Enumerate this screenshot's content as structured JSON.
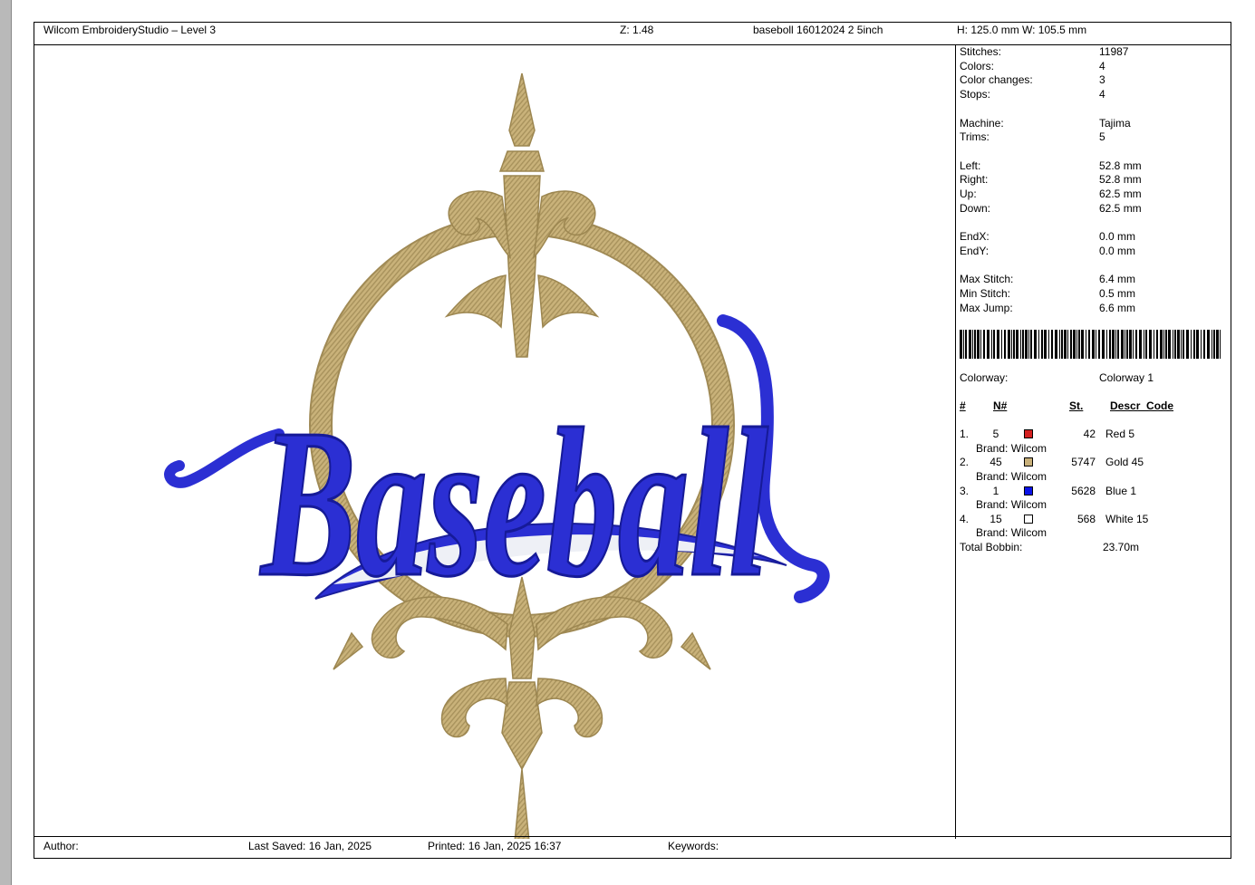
{
  "header": {
    "app_title": "Wilcom EmbroideryStudio – Level 3",
    "zoom": "Z: 1.48",
    "design_name": "baseboll 16012024 2 5inch",
    "dimensions": "H: 125.0 mm   W: 105.5 mm"
  },
  "design": {
    "text": "Baseball",
    "colors": {
      "gold": "#c9b27a",
      "blue": "#2b2fd3",
      "white": "#eef0f6"
    }
  },
  "stats": [
    {
      "label": "Stitches:",
      "value": "11987"
    },
    {
      "label": "Colors:",
      "value": "4"
    },
    {
      "label": "Color changes:",
      "value": "3"
    },
    {
      "label": "Stops:",
      "value": "4"
    },
    {
      "label": "Machine:",
      "value": "Tajima"
    },
    {
      "label": "Trims:",
      "value": "5"
    },
    {
      "label": "Left:",
      "value": "52.8 mm"
    },
    {
      "label": "Right:",
      "value": "52.8 mm"
    },
    {
      "label": "Up:",
      "value": "62.5 mm"
    },
    {
      "label": "Down:",
      "value": "62.5 mm"
    },
    {
      "label": "EndX:",
      "value": "0.0 mm"
    },
    {
      "label": "EndY:",
      "value": "0.0 mm"
    },
    {
      "label": "Max Stitch:",
      "value": "6.4 mm"
    },
    {
      "label": "Min Stitch:",
      "value": "0.5 mm"
    },
    {
      "label": "Max Jump:",
      "value": "6.6 mm"
    }
  ],
  "colorway": {
    "label": "Colorway:",
    "value": "Colorway 1"
  },
  "table_headers": {
    "index": "#",
    "needle": "N#",
    "stitches": "St.",
    "descr": "Descr_Code"
  },
  "threads": [
    {
      "index": "1.",
      "needle": "5",
      "color": "#d42020",
      "stitches": "42",
      "descr": "Red 5",
      "brand": "Brand: Wilcom"
    },
    {
      "index": "2.",
      "needle": "45",
      "color": "#c8b07a",
      "stitches": "5747",
      "descr": "Gold 45",
      "brand": "Brand: Wilcom"
    },
    {
      "index": "3.",
      "needle": "1",
      "color": "#0a12e8",
      "stitches": "5628",
      "descr": "Blue 1",
      "brand": "Brand: Wilcom"
    },
    {
      "index": "4.",
      "needle": "15",
      "color": "#ffffff",
      "stitches": "568",
      "descr": "White 15",
      "brand": "Brand: Wilcom"
    }
  ],
  "total_bobbin": {
    "label": "Total Bobbin:",
    "value": "23.70m"
  },
  "footer": {
    "author": "Author:",
    "last_saved": "Last Saved: 16 Jan, 2025",
    "printed": "Printed: 16 Jan, 2025 16:37",
    "keywords": "Keywords:"
  }
}
